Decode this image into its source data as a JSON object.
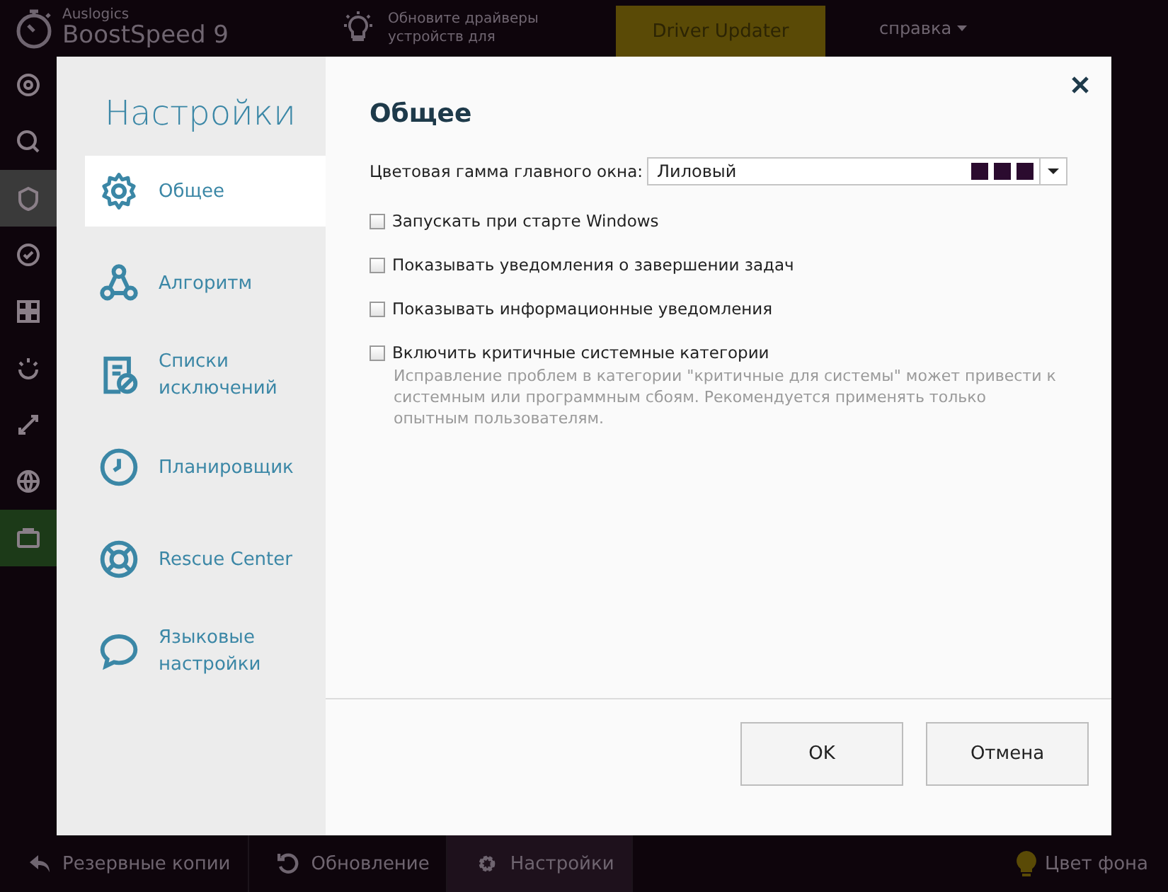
{
  "app": {
    "brand": "Auslogics",
    "product": "BoostSpeed 9",
    "promo_lines": [
      "Обновите драйверы",
      "устройств для"
    ],
    "promo_button": "Driver Updater",
    "help_menu": "справка"
  },
  "rail": [
    {
      "selected": false,
      "highlighted": false
    },
    {
      "selected": false,
      "highlighted": false
    },
    {
      "selected": true,
      "highlighted": false
    },
    {
      "selected": false,
      "highlighted": false
    },
    {
      "selected": false,
      "highlighted": false
    },
    {
      "selected": false,
      "highlighted": false
    },
    {
      "selected": false,
      "highlighted": false
    },
    {
      "selected": false,
      "highlighted": false
    },
    {
      "selected": false,
      "highlighted": true
    }
  ],
  "bottom_bar": {
    "items": [
      {
        "label": "Резервные копии",
        "selected": false
      },
      {
        "label": "Обновление",
        "selected": false
      },
      {
        "label": "Настройки",
        "selected": true
      }
    ],
    "theme_button": "Цвет фона"
  },
  "dialog": {
    "title": "Настройки",
    "sidebar": {
      "items": [
        {
          "label": "Общее",
          "selected": true
        },
        {
          "label": "Алгоритм",
          "selected": false
        },
        {
          "label": "Списки исключений",
          "selected": false
        },
        {
          "label": "Планировщик",
          "selected": false
        },
        {
          "label": "Rescue Center",
          "selected": false
        },
        {
          "label": "Языковые настройки",
          "selected": false
        }
      ]
    },
    "heading": "Общее",
    "color_scheme": {
      "label": "Цветовая гамма главного окна:",
      "value": "Лиловый",
      "swatches": [
        {
          "color": "#2b0b2f"
        },
        {
          "color": "#2b0b2f"
        },
        {
          "color": "#2b0b2f"
        }
      ]
    },
    "options": [
      {
        "label": "Запускать при старте Windows",
        "checked": false
      },
      {
        "label": "Показывать уведомления о завершении задач",
        "checked": false
      },
      {
        "label": "Показывать информационные уведомления",
        "checked": false
      },
      {
        "label": "Включить критичные системные категории",
        "checked": false,
        "note": "Исправление проблем в категории \"критичные для системы\" может привести к системным или программным сбоям. Рекомендуется применять только опытным пользователям."
      }
    ],
    "buttons": [
      "OK",
      "Отмена"
    ]
  }
}
